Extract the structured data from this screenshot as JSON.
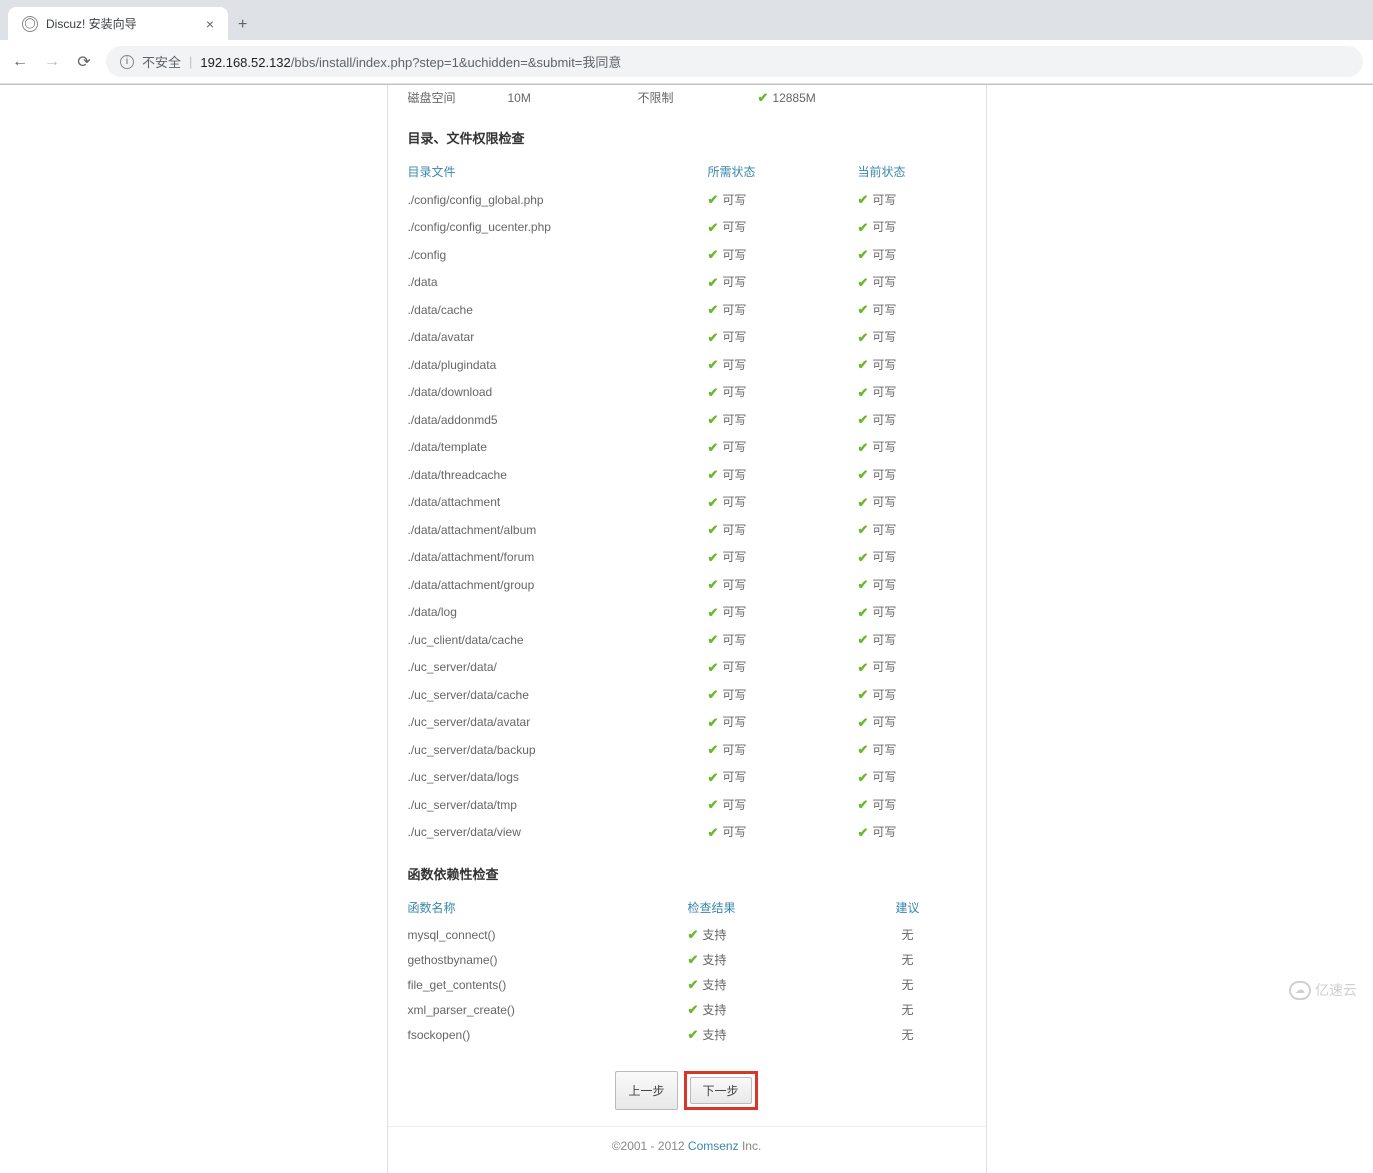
{
  "browser": {
    "tab_title": "Discuz! 安装向导",
    "insecure_label": "不安全",
    "url_host": "192.168.52.132",
    "url_path": "/bbs/install/index.php?step=1&uchidden=&submit=我同意"
  },
  "env_partial": {
    "label": "磁盘空间",
    "min": "10M",
    "best": "不限制",
    "current": "12885M"
  },
  "sections": {
    "perm_title": "目录、文件权限检查",
    "func_title": "函数依赖性检查"
  },
  "perm_headers": {
    "col1": "目录文件",
    "col2": "所需状态",
    "col3": "当前状态"
  },
  "perm_status": "可写",
  "perm_rows": [
    "./config/config_global.php",
    "./config/config_ucenter.php",
    "./config",
    "./data",
    "./data/cache",
    "./data/avatar",
    "./data/plugindata",
    "./data/download",
    "./data/addonmd5",
    "./data/template",
    "./data/threadcache",
    "./data/attachment",
    "./data/attachment/album",
    "./data/attachment/forum",
    "./data/attachment/group",
    "./data/log",
    "./uc_client/data/cache",
    "./uc_server/data/",
    "./uc_server/data/cache",
    "./uc_server/data/avatar",
    "./uc_server/data/backup",
    "./uc_server/data/logs",
    "./uc_server/data/tmp",
    "./uc_server/data/view"
  ],
  "func_headers": {
    "f1": "函数名称",
    "f2": "检查结果",
    "f3": "建议"
  },
  "func_status": "支持",
  "func_advice": "无",
  "func_rows": [
    "mysql_connect()",
    "gethostbyname()",
    "file_get_contents()",
    "xml_parser_create()",
    "fsockopen()"
  ],
  "buttons": {
    "prev": "上一步",
    "next": "下一步"
  },
  "footer": {
    "copyright": "©2001 - 2012 ",
    "link": "Comsenz",
    "suffix": " Inc."
  },
  "watermark": "亿速云"
}
